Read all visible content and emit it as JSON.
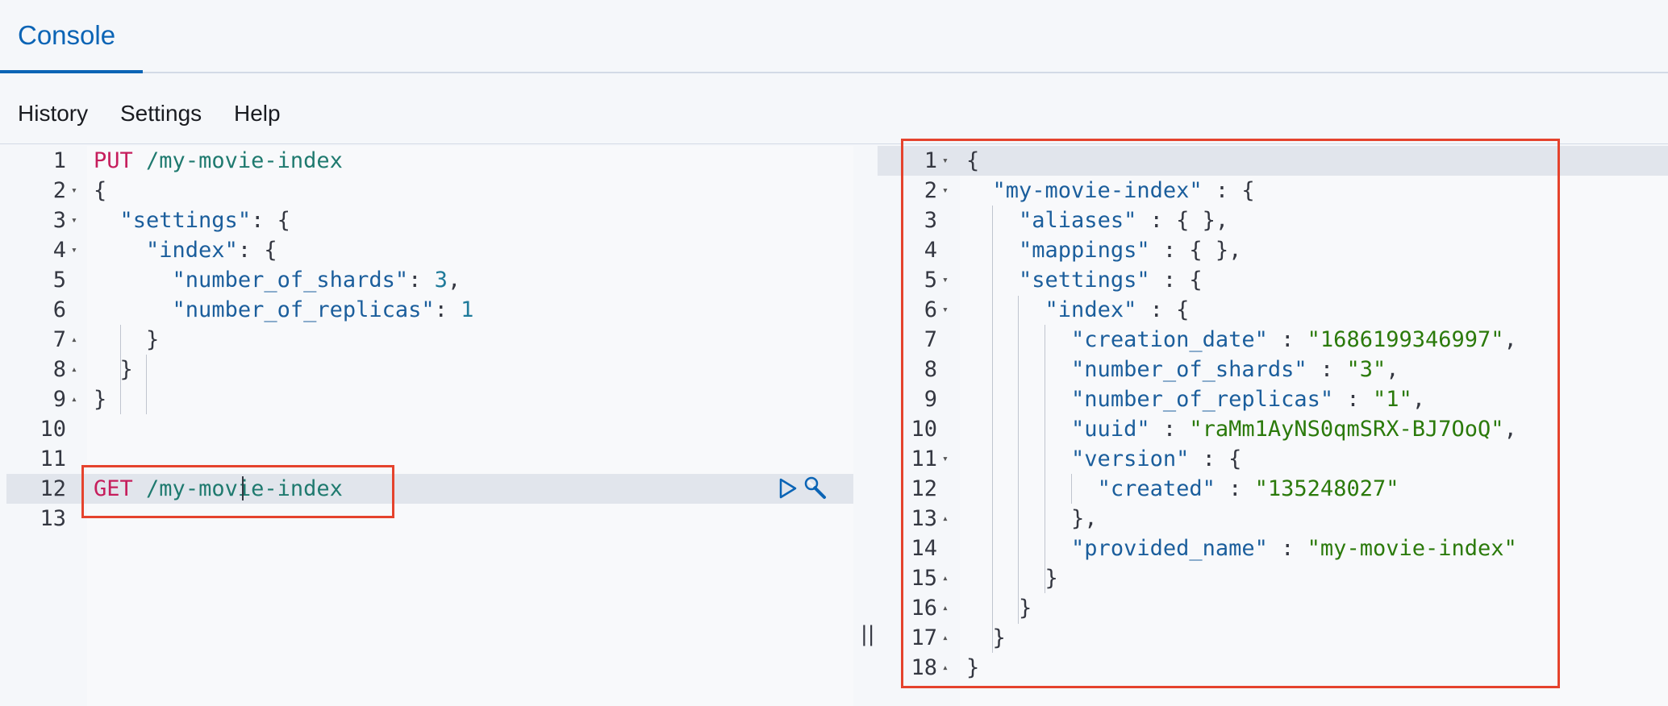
{
  "tabs": {
    "console": "Console"
  },
  "menu": {
    "history": "History",
    "settings": "Settings",
    "help": "Help"
  },
  "splitter_glyph": "||",
  "request_editor": {
    "lines": [
      {
        "n": "1",
        "fold": "",
        "tokens": [
          [
            "method",
            "PUT"
          ],
          [
            "plain",
            " "
          ],
          [
            "path",
            "/my-movie-index"
          ]
        ]
      },
      {
        "n": "2",
        "fold": "▾",
        "tokens": [
          [
            "plain",
            "{"
          ]
        ]
      },
      {
        "n": "3",
        "fold": "▾",
        "tokens": [
          [
            "plain",
            "  "
          ],
          [
            "key",
            "\"settings\""
          ],
          [
            "plain",
            ": {"
          ]
        ]
      },
      {
        "n": "4",
        "fold": "▾",
        "tokens": [
          [
            "plain",
            "    "
          ],
          [
            "key",
            "\"index\""
          ],
          [
            "plain",
            ": {"
          ]
        ]
      },
      {
        "n": "5",
        "fold": "",
        "tokens": [
          [
            "plain",
            "      "
          ],
          [
            "key",
            "\"number_of_shards\""
          ],
          [
            "plain",
            ": "
          ],
          [
            "num",
            "3"
          ],
          [
            "plain",
            ","
          ]
        ]
      },
      {
        "n": "6",
        "fold": "",
        "tokens": [
          [
            "plain",
            "      "
          ],
          [
            "key",
            "\"number_of_replicas\""
          ],
          [
            "plain",
            ": "
          ],
          [
            "num",
            "1"
          ]
        ]
      },
      {
        "n": "7",
        "fold": "▴",
        "tokens": [
          [
            "plain",
            "    }"
          ]
        ]
      },
      {
        "n": "8",
        "fold": "▴",
        "tokens": [
          [
            "plain",
            "  }"
          ]
        ]
      },
      {
        "n": "9",
        "fold": "▴",
        "tokens": [
          [
            "plain",
            "}"
          ]
        ]
      },
      {
        "n": "10",
        "fold": "",
        "tokens": []
      },
      {
        "n": "11",
        "fold": "",
        "tokens": []
      },
      {
        "n": "12",
        "fold": "",
        "tokens": [
          [
            "method",
            "GET"
          ],
          [
            "plain",
            " "
          ],
          [
            "path",
            "/my-movie-index"
          ]
        ],
        "active": true
      },
      {
        "n": "13",
        "fold": "",
        "tokens": []
      }
    ]
  },
  "response_viewer": {
    "lines": [
      {
        "n": "1",
        "fold": "▾",
        "tokens": [
          [
            "plain",
            "{"
          ]
        ],
        "active": true
      },
      {
        "n": "2",
        "fold": "▾",
        "tokens": [
          [
            "plain",
            "  "
          ],
          [
            "key",
            "\"my-movie-index\""
          ],
          [
            "plain",
            " : {"
          ]
        ]
      },
      {
        "n": "3",
        "fold": "",
        "tokens": [
          [
            "plain",
            "    "
          ],
          [
            "key",
            "\"aliases\""
          ],
          [
            "plain",
            " : { },"
          ]
        ]
      },
      {
        "n": "4",
        "fold": "",
        "tokens": [
          [
            "plain",
            "    "
          ],
          [
            "key",
            "\"mappings\""
          ],
          [
            "plain",
            " : { },"
          ]
        ]
      },
      {
        "n": "5",
        "fold": "▾",
        "tokens": [
          [
            "plain",
            "    "
          ],
          [
            "key",
            "\"settings\""
          ],
          [
            "plain",
            " : {"
          ]
        ]
      },
      {
        "n": "6",
        "fold": "▾",
        "tokens": [
          [
            "plain",
            "      "
          ],
          [
            "key",
            "\"index\""
          ],
          [
            "plain",
            " : {"
          ]
        ]
      },
      {
        "n": "7",
        "fold": "",
        "tokens": [
          [
            "plain",
            "        "
          ],
          [
            "key",
            "\"creation_date\""
          ],
          [
            "plain",
            " : "
          ],
          [
            "str",
            "\"1686199346997\""
          ],
          [
            "plain",
            ","
          ]
        ]
      },
      {
        "n": "8",
        "fold": "",
        "tokens": [
          [
            "plain",
            "        "
          ],
          [
            "key",
            "\"number_of_shards\""
          ],
          [
            "plain",
            " : "
          ],
          [
            "str",
            "\"3\""
          ],
          [
            "plain",
            ","
          ]
        ]
      },
      {
        "n": "9",
        "fold": "",
        "tokens": [
          [
            "plain",
            "        "
          ],
          [
            "key",
            "\"number_of_replicas\""
          ],
          [
            "plain",
            " : "
          ],
          [
            "str",
            "\"1\""
          ],
          [
            "plain",
            ","
          ]
        ]
      },
      {
        "n": "10",
        "fold": "",
        "tokens": [
          [
            "plain",
            "        "
          ],
          [
            "key",
            "\"uuid\""
          ],
          [
            "plain",
            " : "
          ],
          [
            "str",
            "\"raMm1AyNS0qmSRX-BJ7OoQ\""
          ],
          [
            "plain",
            ","
          ]
        ]
      },
      {
        "n": "11",
        "fold": "▾",
        "tokens": [
          [
            "plain",
            "        "
          ],
          [
            "key",
            "\"version\""
          ],
          [
            "plain",
            " : {"
          ]
        ]
      },
      {
        "n": "12",
        "fold": "",
        "tokens": [
          [
            "plain",
            "          "
          ],
          [
            "key",
            "\"created\""
          ],
          [
            "plain",
            " : "
          ],
          [
            "str",
            "\"135248027\""
          ]
        ]
      },
      {
        "n": "13",
        "fold": "▴",
        "tokens": [
          [
            "plain",
            "        },"
          ]
        ]
      },
      {
        "n": "14",
        "fold": "",
        "tokens": [
          [
            "plain",
            "        "
          ],
          [
            "key",
            "\"provided_name\""
          ],
          [
            "plain",
            " : "
          ],
          [
            "str",
            "\"my-movie-index\""
          ]
        ]
      },
      {
        "n": "15",
        "fold": "▴",
        "tokens": [
          [
            "plain",
            "      }"
          ]
        ]
      },
      {
        "n": "16",
        "fold": "▴",
        "tokens": [
          [
            "plain",
            "    }"
          ]
        ]
      },
      {
        "n": "17",
        "fold": "▴",
        "tokens": [
          [
            "plain",
            "  }"
          ]
        ]
      },
      {
        "n": "18",
        "fold": "▴",
        "tokens": [
          [
            "plain",
            "}"
          ]
        ]
      }
    ]
  },
  "icons": {
    "run": "play-icon",
    "options": "wrench-icon"
  },
  "colors": {
    "accent": "#0b64b5",
    "highlight_box": "#e5432d",
    "method": "#c61e5c",
    "string": "#2b7a0b"
  }
}
